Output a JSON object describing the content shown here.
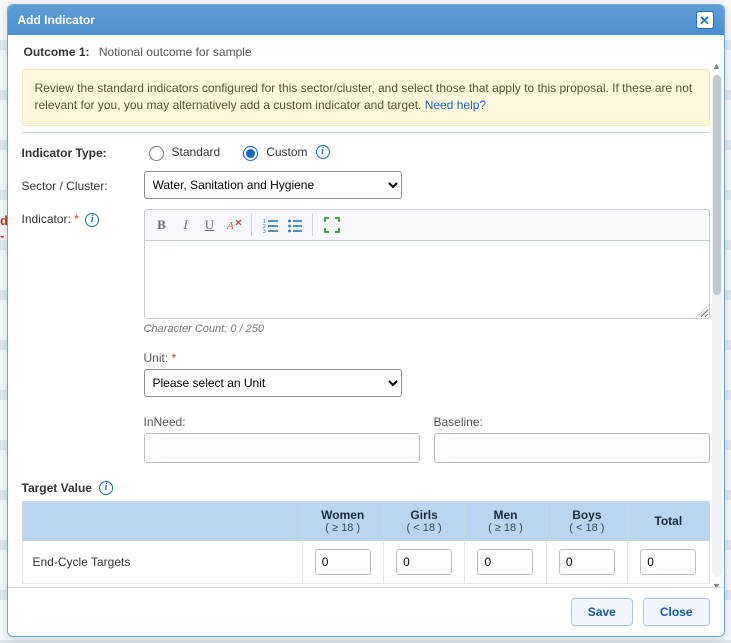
{
  "modal": {
    "title": "Add Indicator",
    "outcome_label": "Outcome 1:",
    "outcome_desc": "Notional outcome for sample",
    "banner_text": "Review the standard indicators configured for this sector/cluster, and select those that apply to this proposal. If these are not relevant for you, you may alternatively add a custom indicator and target. ",
    "banner_link": "Need help?"
  },
  "fields": {
    "indicator_type_label": "Indicator Type:",
    "standard_label": "Standard",
    "custom_label": "Custom",
    "sector_label": "Sector / Cluster:",
    "sector_value": "Water, Sanitation and Hygiene",
    "indicator_label": "Indicator:",
    "char_count": "Character Count: 0 / 250",
    "unit_label": "Unit:",
    "unit_placeholder": "Please select an Unit",
    "inneed_label": "InNeed:",
    "baseline_label": "Baseline:"
  },
  "target": {
    "section_title": "Target Value",
    "cols": [
      {
        "label": "Women",
        "sub": "( ≥ 18 )"
      },
      {
        "label": "Girls",
        "sub": "( < 18 )"
      },
      {
        "label": "Men",
        "sub": "( ≥ 18 )"
      },
      {
        "label": "Boys",
        "sub": "( < 18 )"
      },
      {
        "label": "Total",
        "sub": ""
      }
    ],
    "row_label": "End-Cycle Targets",
    "values": [
      "0",
      "0",
      "0",
      "0",
      "0"
    ]
  },
  "footer": {
    "save": "Save",
    "close": "Close"
  },
  "bg": {
    "red_frag": "d -"
  }
}
